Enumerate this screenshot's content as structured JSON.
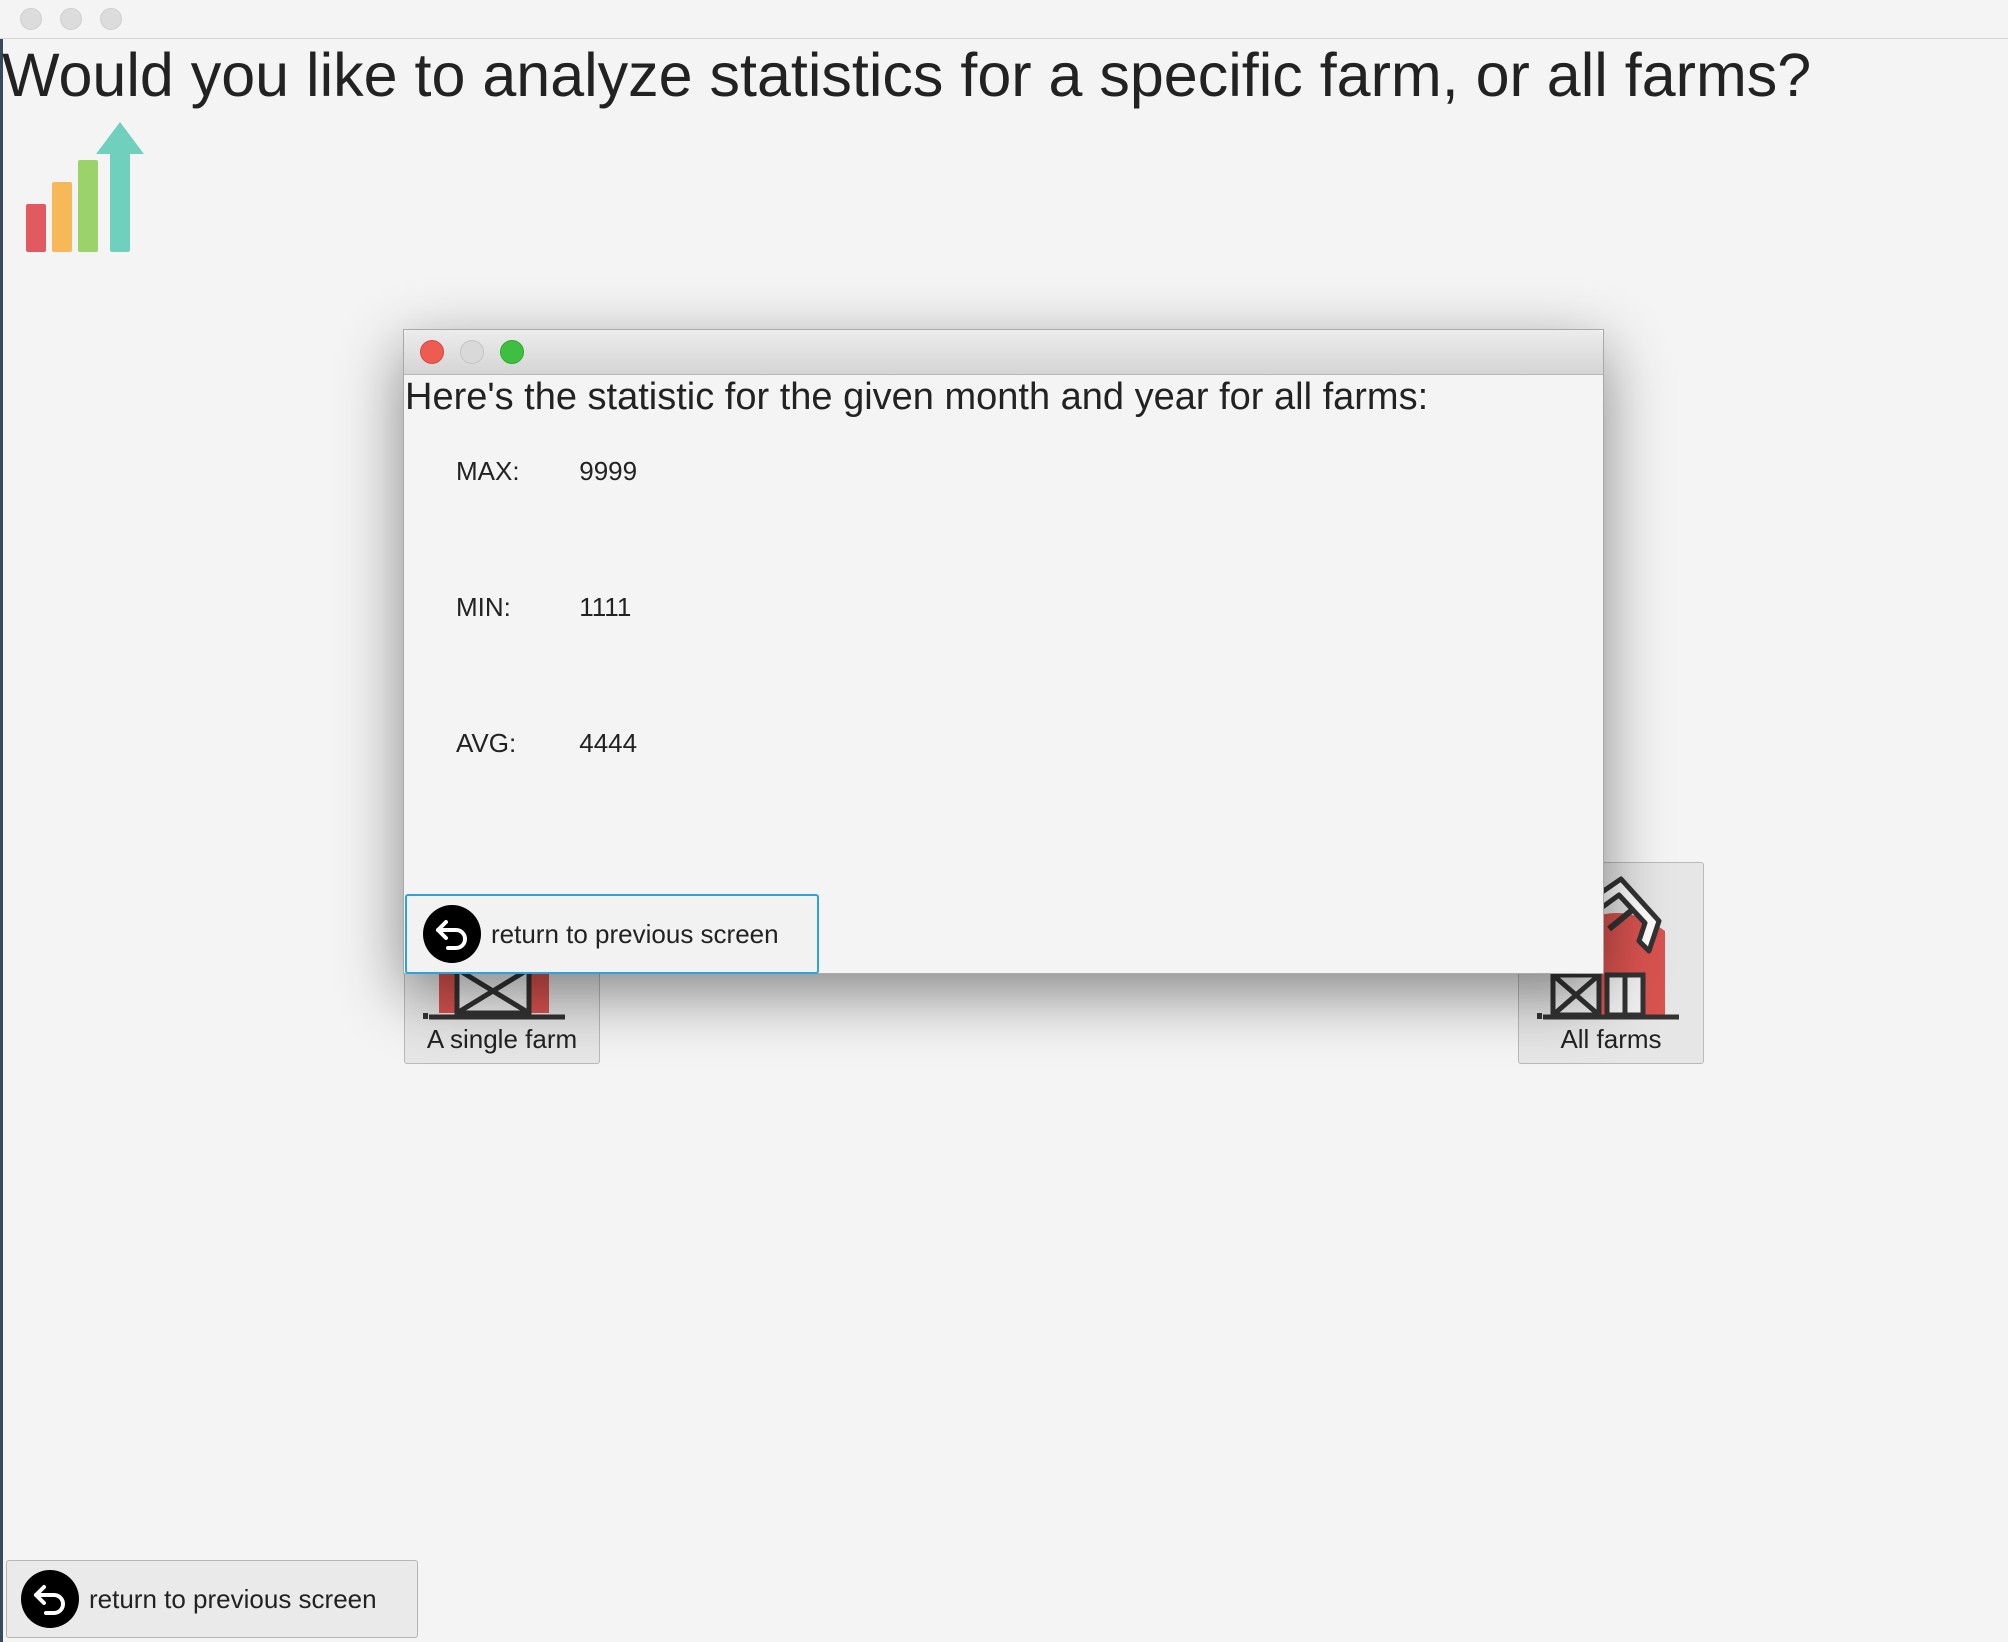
{
  "window": {
    "controls": [
      "close",
      "minimize",
      "zoom"
    ]
  },
  "main": {
    "question": "Would you like to analyze statistics for a specific farm, or all farms?",
    "logo_icon": "bar-chart-growth-icon",
    "options": [
      {
        "label": "A single farm",
        "icon": "barn-icon"
      },
      {
        "label": "All farms",
        "icon": "barn-with-excavator-icon"
      }
    ],
    "return_button": {
      "label": "return to previous screen",
      "icon": "return-arrow-icon"
    }
  },
  "dialog": {
    "message": "Here's the statistic for the given month and year for all farms:",
    "stats": [
      {
        "label": "MAX:",
        "value": "9999"
      },
      {
        "label": "MIN:",
        "value": "1111"
      },
      {
        "label": "AVG:",
        "value": "4444"
      }
    ],
    "return_button": {
      "label": "return to previous screen",
      "icon": "return-arrow-icon"
    }
  },
  "colors": {
    "background": "#f4f4f4",
    "dialog_close": "#ee5b51",
    "dialog_zoom": "#3fbf40",
    "focus_border": "#2ea3d9",
    "barn_red": "#d9534f",
    "bar_red": "#e05a5f",
    "bar_orange": "#f7b85a",
    "bar_green": "#9bd36a",
    "bar_teal": "#6fd1bd"
  }
}
